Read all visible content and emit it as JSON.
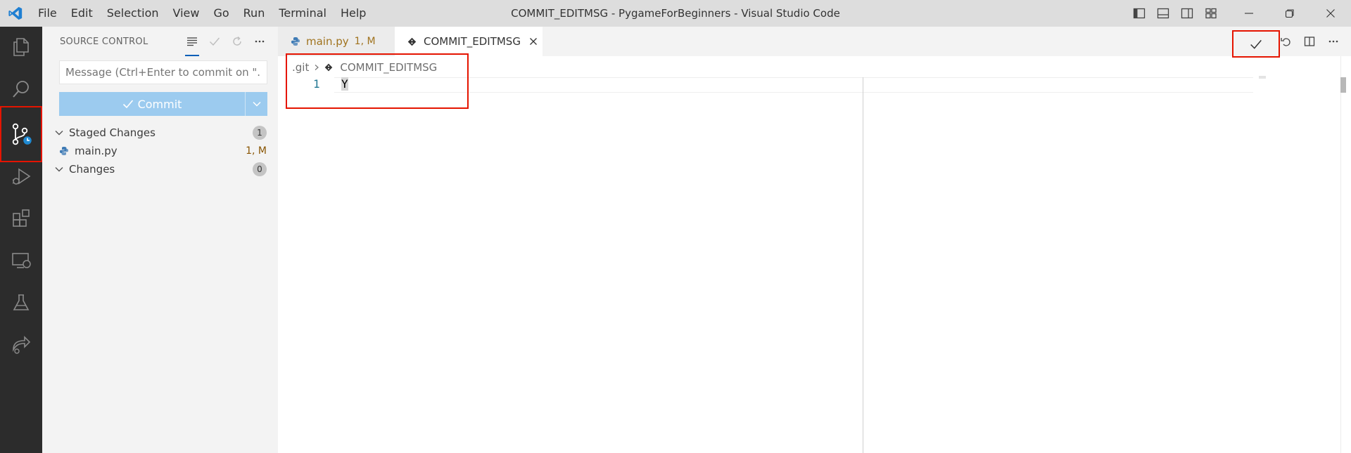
{
  "window": {
    "title": "COMMIT_EDITMSG - PygameForBeginners - Visual Studio Code"
  },
  "menu": {
    "items": [
      "File",
      "Edit",
      "Selection",
      "View",
      "Go",
      "Run",
      "Terminal",
      "Help"
    ]
  },
  "activity_bar": {
    "items": [
      "explorer-icon",
      "search-icon",
      "source-control-icon",
      "run-debug-icon",
      "extensions-icon",
      "remote-explorer-icon",
      "testing-icon",
      "live-share-icon"
    ],
    "active": "source-control-icon"
  },
  "sidebar": {
    "title": "SOURCE CONTROL",
    "message_placeholder": "Message (Ctrl+Enter to commit on \"...",
    "commit_label": "Commit",
    "staged": {
      "label": "Staged Changes",
      "count": "1",
      "files": [
        {
          "name": "main.py",
          "status": "1, M"
        }
      ]
    },
    "changes": {
      "label": "Changes",
      "count": "0"
    }
  },
  "editor": {
    "tabs": [
      {
        "label": "main.py",
        "status": "1, M",
        "active": false
      },
      {
        "label": "COMMIT_EDITMSG",
        "active": true
      }
    ],
    "breadcrumb": {
      "folder": ".git",
      "file": "COMMIT_EDITMSG"
    },
    "lines": [
      {
        "number": "1",
        "text": "Y"
      }
    ]
  },
  "colors": {
    "accent": "#005fb8",
    "commit_button": "#9ccbef",
    "highlight": "#e51400",
    "activity_bar": "#2c2c2c",
    "modified": "#895503"
  }
}
